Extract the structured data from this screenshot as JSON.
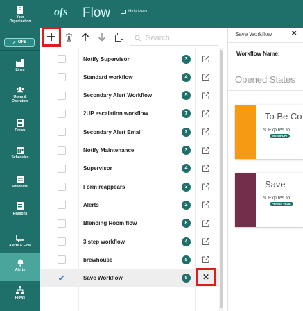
{
  "sidebar": {
    "org": "Your Organisation",
    "ofs_button": "OFS",
    "items": [
      {
        "label": "Lines",
        "icon": "lines-icon"
      },
      {
        "label": "Users & Operators",
        "icon": "users-icon"
      },
      {
        "label": "Crews",
        "icon": "crews-icon"
      },
      {
        "label": "Schedules",
        "icon": "schedules-icon"
      },
      {
        "label": "Products",
        "icon": "products-icon"
      },
      {
        "label": "Reasons",
        "icon": "reasons-icon"
      },
      {
        "label": "Alerts & Flow",
        "icon": "alerts-flow-icon"
      },
      {
        "label": "Alerts",
        "icon": "alerts-icon"
      },
      {
        "label": "Flows",
        "icon": "flows-icon"
      }
    ]
  },
  "header": {
    "logo": "ofs",
    "title": "Flow",
    "hide_menu": "Hide Menu"
  },
  "toolbar": {
    "search_placeholder": "Search"
  },
  "workflows": [
    {
      "name": "Notify Supervisor",
      "count": "3",
      "checked": false
    },
    {
      "name": "Standard workflow",
      "count": "4",
      "checked": false
    },
    {
      "name": "Secondary Alert Workflow",
      "count": "5",
      "checked": false
    },
    {
      "name": "2UP escalation workflow",
      "count": "7",
      "checked": false
    },
    {
      "name": "Secondary Alert Email",
      "count": "2",
      "checked": false
    },
    {
      "name": "Notify Maintenance",
      "count": "3",
      "checked": false
    },
    {
      "name": "Supervisor",
      "count": "4",
      "checked": false
    },
    {
      "name": "Form reappears",
      "count": "3",
      "checked": false
    },
    {
      "name": "Alerts",
      "count": "2",
      "checked": false
    },
    {
      "name": "Blending Room flow",
      "count": "8",
      "checked": false
    },
    {
      "name": "3 step workflow",
      "count": "4",
      "checked": false
    },
    {
      "name": "brewhouse",
      "count": "5",
      "checked": false
    },
    {
      "name": "Save Workflow",
      "count": "5",
      "checked": true
    }
  ],
  "panel": {
    "title": "Save Workflow",
    "workflow_name_label": "Workflow Name:",
    "opened_states": "Opened States",
    "states": [
      {
        "name": "To Be Co",
        "expires": "Expires to",
        "tag": "INTERRUPT",
        "color": "#f59a12"
      },
      {
        "name": "Save",
        "expires": "Expires to",
        "tag": "PERMIT VALID",
        "color": "#722f4c"
      }
    ]
  },
  "colors": {
    "brand": "#1f6f6b",
    "highlight": "#e01b1b"
  }
}
